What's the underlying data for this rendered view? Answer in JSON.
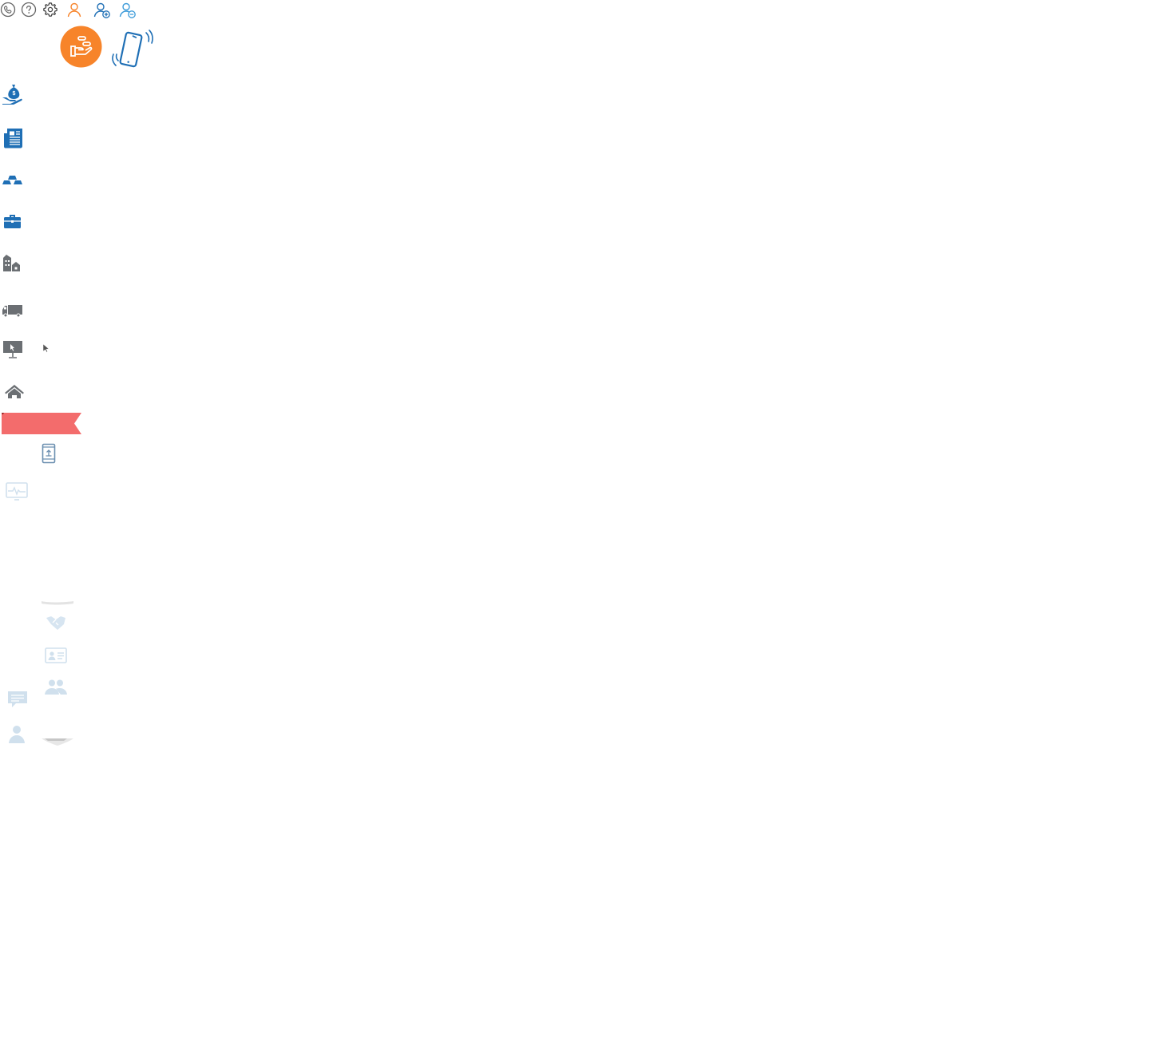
{
  "colors": {
    "primary_blue": "#1f6fb5",
    "orange": "#f7842a",
    "gray": "#555555",
    "dark_gray": "#6b6f73",
    "ribbon": "#f36c6c",
    "faint_blue": "#c9ddec"
  },
  "top_bar": {
    "icons": [
      "phone-icon",
      "help-icon",
      "settings-icon",
      "user-icon",
      "add-user-icon",
      "remove-user-icon"
    ]
  },
  "hero": {
    "icons": [
      "payment-hand-icon",
      "vibrating-phone-icon"
    ]
  },
  "nav": {
    "items": [
      {
        "icon": "money-bag-hand-icon"
      },
      {
        "icon": "newspaper-icon"
      },
      {
        "icon": "gold-bars-icon"
      },
      {
        "icon": "briefcase-icon"
      },
      {
        "icon": "buildings-icon"
      },
      {
        "icon": "truck-icon"
      },
      {
        "icon": "presentation-icon"
      },
      {
        "icon": "home-icon"
      }
    ]
  },
  "ribbon": {
    "color": "#f36c6c"
  },
  "secondary": {
    "icons": [
      "mobile-upload-icon",
      "monitor-pulse-icon",
      "handshake-icon",
      "id-card-icon",
      "users-group-icon",
      "chat-icon",
      "person-icon"
    ]
  }
}
